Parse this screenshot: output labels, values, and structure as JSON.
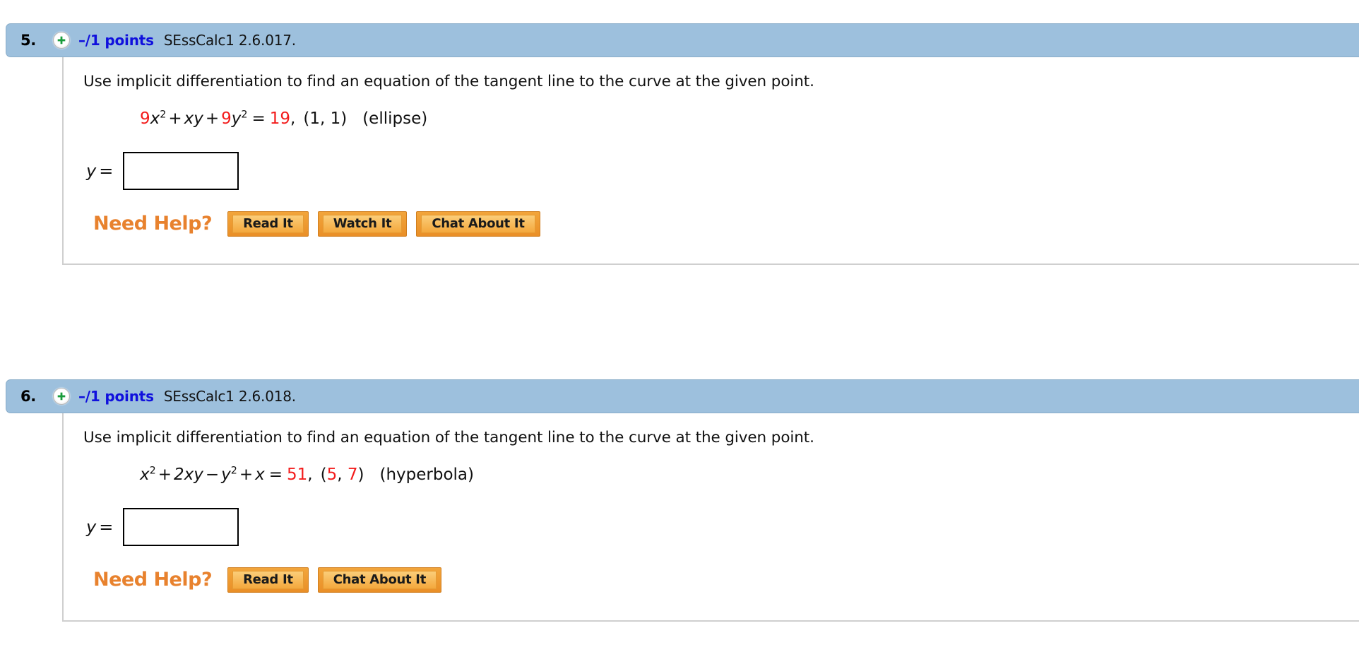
{
  "problems": [
    {
      "number": "5.",
      "points": "–/1 points",
      "code": "SEssCalc1 2.6.017.",
      "plus_icon": "plus-circle-icon",
      "prompt": "Use implicit differentiation to find an equation of the tangent line to the curve at the given point.",
      "equation": {
        "coef1": "9",
        "term1_var": "x",
        "exp1": "2",
        "op1": "+",
        "term2": "xy",
        "op2": "+",
        "coef3": "9",
        "term3_var": "y",
        "exp3": "2",
        "equals": "=",
        "rhs": "19",
        "comma": ",",
        "point": "(1, 1)",
        "shape": "(ellipse)"
      },
      "answer_label": "y",
      "answer_equals": "=",
      "answer_value": "",
      "answer_placeholder": "",
      "need_help_label": "Need Help?",
      "buttons": [
        "Read It",
        "Watch It",
        "Chat About It"
      ]
    },
    {
      "number": "6.",
      "points": "–/1 points",
      "code": "SEssCalc1 2.6.018.",
      "plus_icon": "plus-circle-icon",
      "prompt": "Use implicit differentiation to find an equation of the tangent line to the curve at the given point.",
      "equation": {
        "coef1": "",
        "term1_var": "x",
        "exp1": "2",
        "op1": "+",
        "term2": "2xy",
        "op2": "−",
        "coef3": "",
        "term3_var": "y",
        "exp3": "2",
        "op3": "+",
        "term4": "x",
        "equals": "=",
        "rhs": "51",
        "comma": ",",
        "point_open": "(",
        "point_x": "5",
        "point_sep": ", ",
        "point_y": "7",
        "point_close": ")",
        "shape": "(hyperbola)"
      },
      "answer_label": "y",
      "answer_equals": "=",
      "answer_value": "",
      "answer_placeholder": "",
      "need_help_label": "Need Help?",
      "buttons": [
        "Read It",
        "Chat About It"
      ]
    }
  ],
  "colors": {
    "header_blue": "#9dc0dd",
    "points_blue": "#1010dd",
    "equation_red": "#f31c1c",
    "need_help_orange": "#e8822e",
    "button_orange": "#f2a53b",
    "panel_border": "#cfcfcf"
  }
}
